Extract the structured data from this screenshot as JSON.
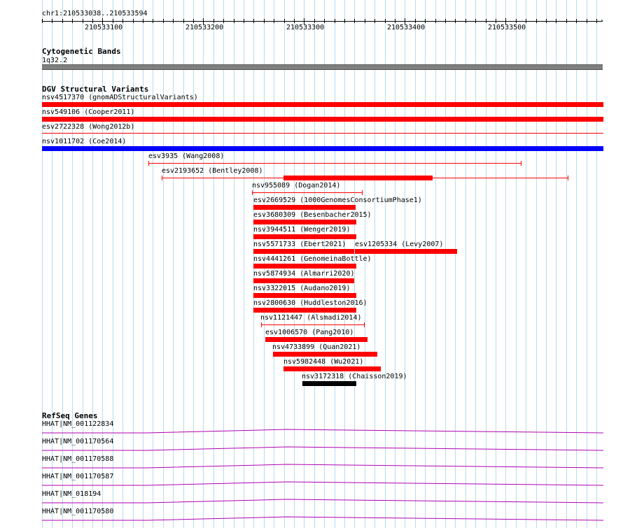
{
  "ruler": {
    "range_label": "chr1:210533038..210533594",
    "ticks": [
      "210533100",
      "210533200",
      "210533300",
      "210533400",
      "210533500"
    ]
  },
  "cytoband": {
    "title": "Cytogenetic Bands",
    "band_label": "1q32.2"
  },
  "dgv": {
    "title": "DGV Structural Variants",
    "colors": {
      "loss": "#ff0000",
      "gain": "#0000ff",
      "complex": "#000000"
    },
    "variants": [
      {
        "label": "nsv4517370 (gnomADStructuralVariants)",
        "type": "loss"
      },
      {
        "label": "nsv549106 (Cooper2011)",
        "type": "loss"
      },
      {
        "label": "esv2722328 (Wong2012b)",
        "type": "loss"
      },
      {
        "label": "nsv1011702 (Coe2014)",
        "type": "gain"
      },
      {
        "label": "esv3935 (Wang2008)",
        "type": "loss"
      },
      {
        "label": "esv2193652 (Bentley2008)",
        "type": "loss"
      },
      {
        "label": "nsv955089 (Dogan2014)",
        "type": "loss"
      },
      {
        "label": "esv2669529 (1000GenomesConsortiumPhase1)",
        "type": "loss"
      },
      {
        "label": "esv3680309 (Besenbacher2015)",
        "type": "loss"
      },
      {
        "label": "nsv3944511 (Wenger2019)",
        "type": "loss"
      },
      {
        "label": "nsv5571733 (Ebert2021)",
        "type": "loss"
      },
      {
        "label": "esv1205334 (Levy2007)",
        "type": "loss"
      },
      {
        "label": "nsv4441261 (GenomeinaBottle)",
        "type": "loss"
      },
      {
        "label": "nsv5874934 (Almarri2020)",
        "type": "loss"
      },
      {
        "label": "nsv3322015 (Audano2019)",
        "type": "loss"
      },
      {
        "label": "nsv2800630 (Huddleston2016)",
        "type": "loss"
      },
      {
        "label": "nsv1121447 (Alsmadi2014)",
        "type": "loss"
      },
      {
        "label": "esv1006570 (Pang2010)",
        "type": "loss"
      },
      {
        "label": "nsv4733899 (Quan2021)",
        "type": "loss"
      },
      {
        "label": "nsv5982448 (Wu2021)",
        "type": "loss"
      },
      {
        "label": "nsv3172318 (Chaisson2019)",
        "type": "complex"
      }
    ]
  },
  "refseq": {
    "title": "RefSeq Genes",
    "color": "#b000b0",
    "genes": [
      {
        "label": "HHAT|NM_001122834"
      },
      {
        "label": "HHAT|NM_001170564"
      },
      {
        "label": "HHAT|NM_001170588"
      },
      {
        "label": "HHAT|NM_001170587"
      },
      {
        "label": "HHAT|NM_018194"
      },
      {
        "label": "HHAT|NM_001170580"
      }
    ]
  },
  "band_color": "#808080",
  "grid_color": "#b8dcec"
}
